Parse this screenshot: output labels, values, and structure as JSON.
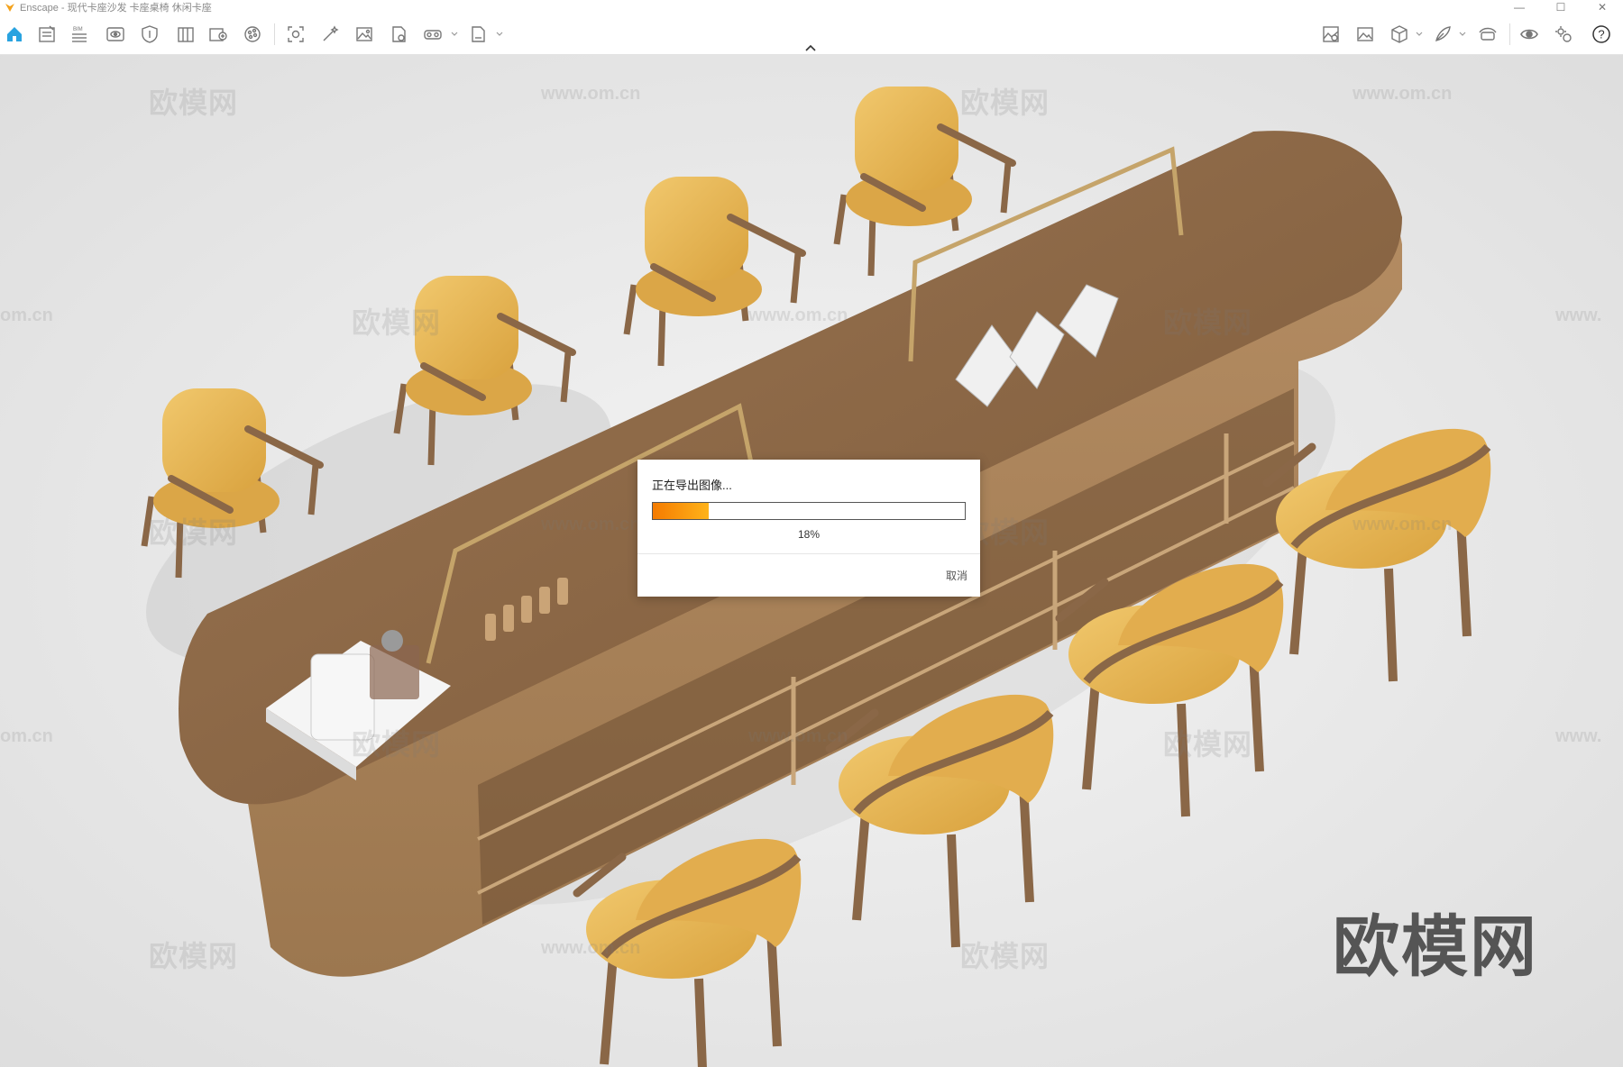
{
  "window": {
    "app_name": "Enscape",
    "title": "Enscape - 现代卡座沙发 卡座桌椅 休闲卡座",
    "controls": {
      "minimize": "—",
      "maximize": "☐",
      "close": "✕"
    }
  },
  "toolbar": {
    "left_icons": [
      "home-icon",
      "project-icon",
      "bim-icon",
      "view-icon",
      "safe-frame-icon",
      "library-icon",
      "asset-library-icon",
      "material-icon",
      "capture-icon",
      "magic-wand-icon",
      "screenshot-icon",
      "batch-render-icon",
      "vr-headset-icon",
      "export-file-icon"
    ],
    "right_icons": [
      "gallery-icon",
      "image-icon",
      "cube-icon",
      "feather-icon",
      "vr-icon",
      "visibility-icon",
      "settings-icon",
      "help-icon"
    ],
    "bim_label": "BIM",
    "help_label": "?"
  },
  "dialog": {
    "title": "正在导出图像...",
    "progress_percent": 18,
    "progress_label": "18%",
    "cancel_label": "取消"
  },
  "watermarks": {
    "brand": "欧模网",
    "url": "www.om.cn",
    "url_partial": "om.cn",
    "url_edge": "www."
  },
  "colors": {
    "accent": "#29a3e0",
    "progress_start": "#f47b00",
    "progress_end": "#ffb31a",
    "wood": "#8f6a45",
    "upholstery": "#e8b454",
    "background": "#ececec"
  }
}
